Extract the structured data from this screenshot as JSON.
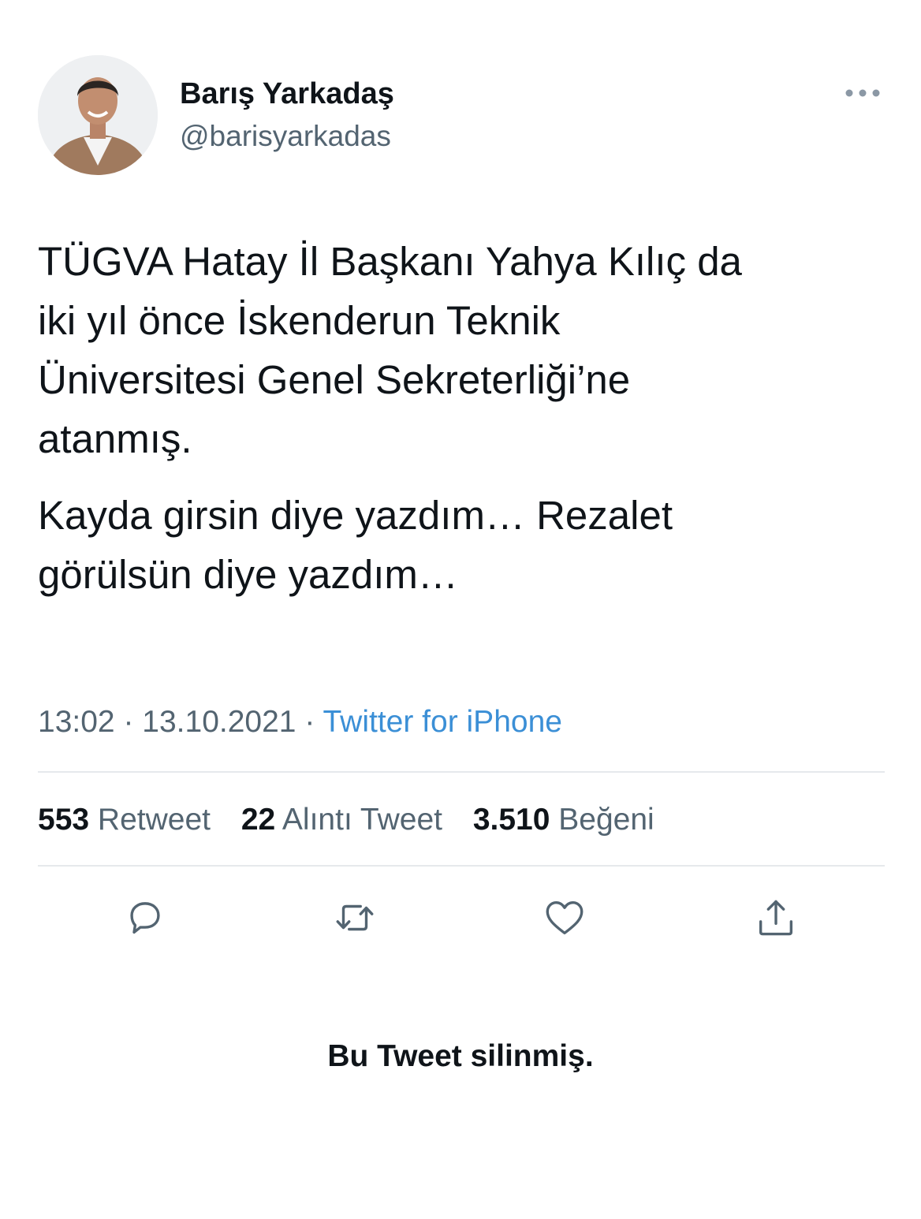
{
  "author": {
    "display_name": "Barış Yarkadaş",
    "handle": "@barisyarkadas",
    "avatar_icon": "profile-photo"
  },
  "header": {
    "more_icon": "more-dots-icon"
  },
  "tweet": {
    "paragraphs": [
      "TÜGVA Hatay İl Başkanı Yahya Kılıç da\niki yıl önce İskenderun Teknik\nÜniversitesi Genel Sekreterliği’ne\natanmış.",
      "Kayda girsin diye yazdım… Rezalet\ngörülsün diye yazdım…"
    ],
    "time": "13:02",
    "date": "13.10.2021",
    "separator": "·",
    "source": "Twitter for iPhone"
  },
  "stats": [
    {
      "count": "553",
      "label": "Retweet"
    },
    {
      "count": "22",
      "label": "Alıntı Tweet"
    },
    {
      "count": "3.510",
      "label": "Beğeni"
    }
  ],
  "actions": [
    {
      "name": "reply",
      "icon": "reply-icon"
    },
    {
      "name": "retweet",
      "icon": "retweet-icon"
    },
    {
      "name": "like",
      "icon": "heart-icon"
    },
    {
      "name": "share",
      "icon": "share-icon"
    }
  ],
  "notice": "Bu Tweet silinmiş.",
  "colors": {
    "text": "#0f1419",
    "secondary": "#536471",
    "link": "#3b8fd6",
    "divider": "#e6e9ec"
  }
}
